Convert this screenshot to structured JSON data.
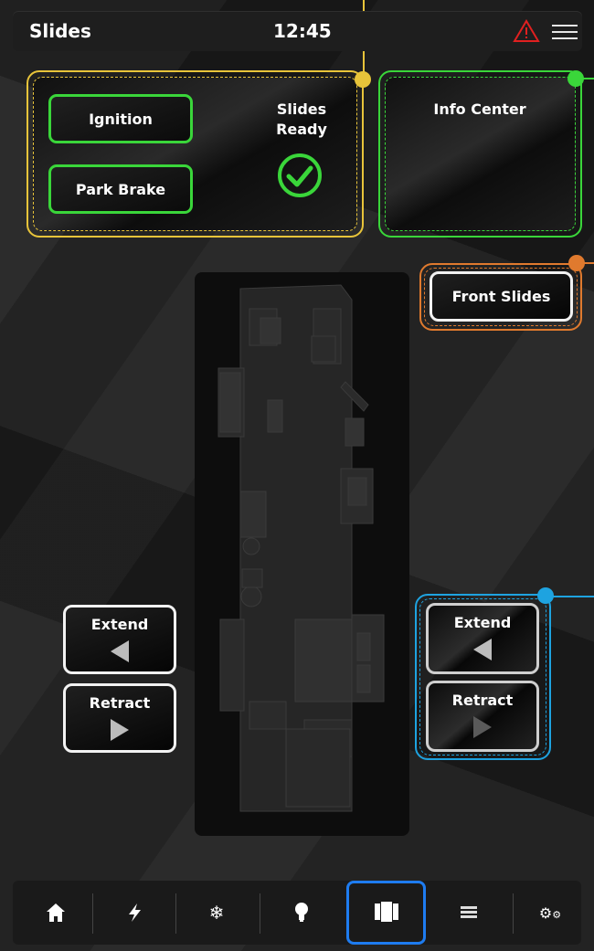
{
  "header": {
    "title": "Slides",
    "clock": "12:45",
    "alert_icon": "warning-icon",
    "menu_icon": "hamburger-menu-icon"
  },
  "colors": {
    "ready_panel": "#e8c43a",
    "info_panel": "#3ad63a",
    "front_slides_panel": "#e07a2e",
    "slide_controls_panel": "#1ea3e0",
    "nav_active": "#1e7cf0",
    "alert": "#e02020"
  },
  "status_panel": {
    "ignition_label": "Ignition",
    "park_brake_label": "Park Brake",
    "ready_line1": "Slides",
    "ready_line2": "Ready",
    "ready_icon": "check-circle-icon"
  },
  "info_panel": {
    "title": "Info Center"
  },
  "front_slides": {
    "label": "Front Slides"
  },
  "left_controls": {
    "extend_label": "Extend",
    "retract_label": "Retract"
  },
  "right_controls": {
    "extend_label": "Extend",
    "retract_label": "Retract"
  },
  "nav": {
    "items": [
      {
        "icon": "home-icon",
        "active": false
      },
      {
        "icon": "lightning-icon",
        "active": false
      },
      {
        "icon": "snowflake-icon",
        "active": false
      },
      {
        "icon": "lightbulb-icon",
        "active": false
      },
      {
        "icon": "slides-icon",
        "active": true
      },
      {
        "icon": "list-icon",
        "active": false
      },
      {
        "icon": "gears-icon",
        "active": false
      }
    ]
  }
}
